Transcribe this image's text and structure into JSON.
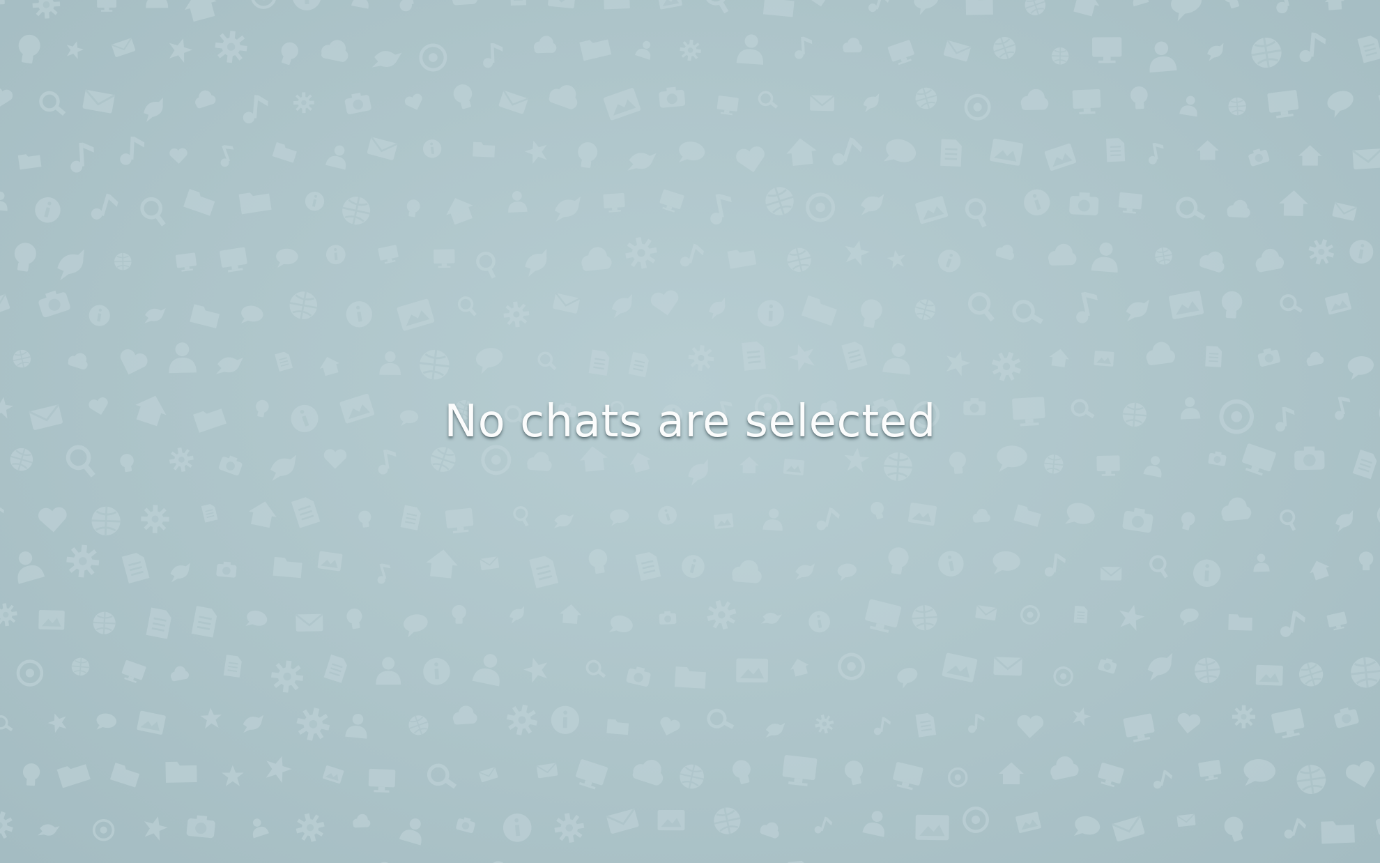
{
  "chat_pane": {
    "empty_message": "No chats are selected"
  },
  "colors": {
    "background": "#adc4c9",
    "pattern_icon": "#c3d6da",
    "message_text": "#fbfcfc"
  },
  "wallpaper": {
    "icons": [
      "chat-bubble-icon",
      "envelope-icon",
      "globe-icon",
      "house-icon",
      "person-icon",
      "monitor-icon",
      "camera-icon",
      "music-note-icon",
      "at-sign-icon",
      "lightbulb-icon",
      "gear-icon",
      "heart-icon",
      "star-icon",
      "info-icon",
      "magnifier-icon",
      "document-icon",
      "picture-icon",
      "cloud-icon",
      "bird-icon",
      "folder-icon"
    ]
  }
}
